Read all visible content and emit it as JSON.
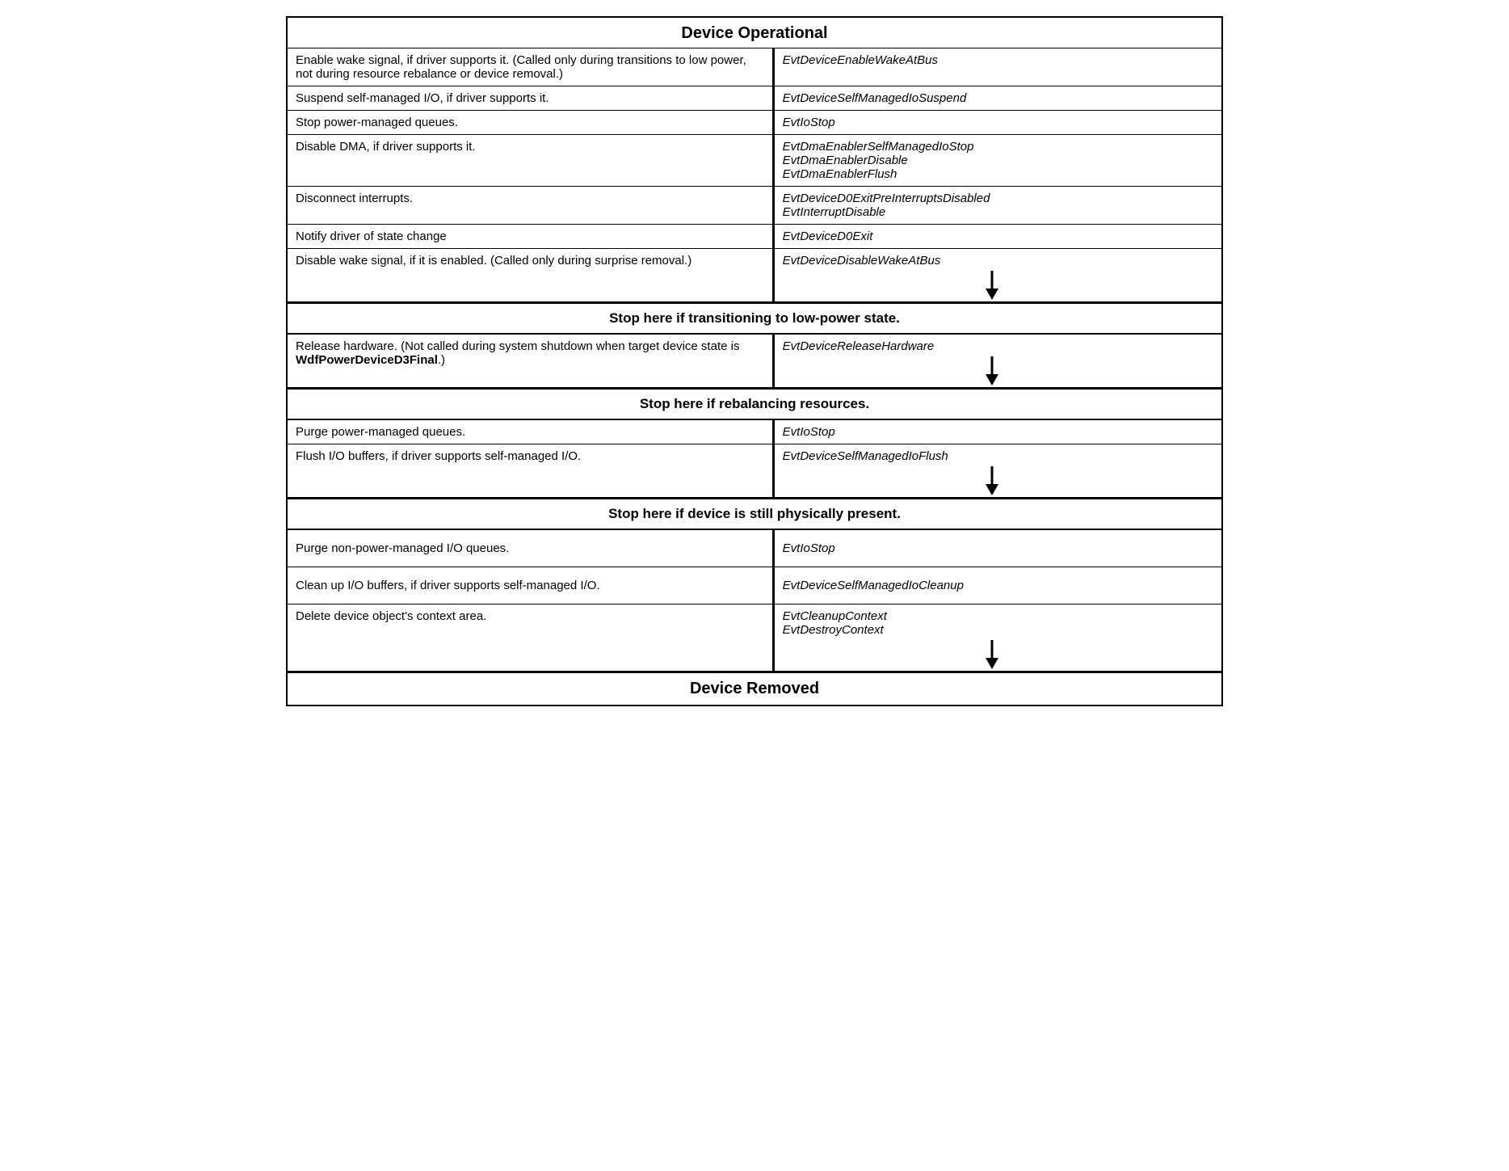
{
  "title": "Device Operational",
  "footer": "Device Removed",
  "sections": {
    "divider1": "Stop here if transitioning to low-power state.",
    "divider2": "Stop here if rebalancing resources.",
    "divider3": "Stop here if device is still physically present."
  },
  "rows": [
    {
      "left": "Enable wake signal, if driver supports it. (Called only during transitions to low power, not during resource rebalance or device removal.)",
      "right": "EvtDeviceEnableWakeAtBus",
      "arrow": false
    },
    {
      "left": "Suspend self-managed I/O, if driver supports it.",
      "right": "EvtDeviceSelfManagedIoSuspend",
      "arrow": false
    },
    {
      "left": "Stop power-managed queues.",
      "right": "EvtIoStop",
      "arrow": false
    },
    {
      "left": "Disable DMA, if driver supports it.",
      "right": "EvtDmaEnablerSelfManagedIoStop\nEvtDmaEnablerDisable\nEvtDmaEnablerFlush",
      "arrow": false
    },
    {
      "left": "Disconnect interrupts.",
      "right": "EvtDeviceD0ExitPreInterruptsDisabled\nEvtInterruptDisable",
      "arrow": false
    },
    {
      "left": "Notify driver of state change",
      "right": "EvtDeviceD0Exit",
      "arrow": false
    },
    {
      "left": "Disable wake signal, if it is enabled. (Called only during surprise removal.)",
      "right": "EvtDeviceDisableWakeAtBus",
      "arrow": true
    }
  ],
  "rows2": [
    {
      "left": "Release hardware. (Not called during system shutdown when target device state is WdfPowerDeviceD3Final.)",
      "left_bold": "WdfPowerDeviceD3Final",
      "right": "EvtDeviceReleaseHardware",
      "arrow": true
    }
  ],
  "rows3": [
    {
      "left": "Purge power-managed queues.",
      "right": "EvtIoStop",
      "arrow": false
    },
    {
      "left": "Flush I/O buffers, if driver supports self-managed I/O.",
      "right": "EvtDeviceSelfManagedIoFlush",
      "arrow": true
    }
  ],
  "rows4": [
    {
      "left": "Purge non-power-managed I/O queues.",
      "right": "EvtIoStop",
      "arrow": false,
      "extra_space": true
    },
    {
      "left": "Clean up I/O buffers, if driver supports self-managed I/O.",
      "right": "EvtDeviceSelfManagedIoCleanup",
      "arrow": false,
      "extra_space": true
    },
    {
      "left": "Delete device object's context area.",
      "right": "EvtCleanupContext\nEvtDestroyContext",
      "arrow": true
    }
  ]
}
